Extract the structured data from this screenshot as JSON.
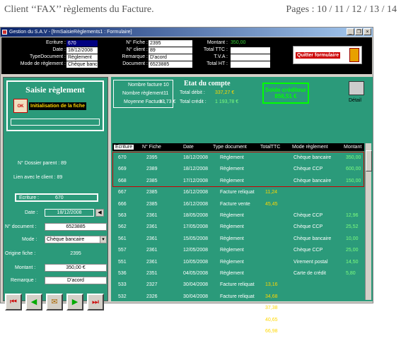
{
  "page_header": {
    "title": "Client ‘‘FAX’’ règlements du Facture.",
    "pages": "Pages : 10 / 11 / 12 / 13 / 14"
  },
  "window": {
    "title": "Gestion du S.A.V - [frmSaisieRèglements1 : Formulaire]",
    "min": "_",
    "restore": "❐",
    "close": "×"
  },
  "top": {
    "ecriture_label": "Ecriture :",
    "ecriture": "670",
    "date_label": "Date :",
    "date": "18/12/2008",
    "typedoc_label": "TypeDocument :",
    "typedoc": "Règlement",
    "mode_label": "Mode de règlement :",
    "mode": "Chèque bancaire",
    "nfiche_label": "N° Fiche :",
    "nfiche": "2395",
    "nclient_label": "N° client :",
    "nclient": "89",
    "remarque_label": "Remarque :",
    "remarque": "D'acord",
    "document_label": "Document :",
    "document": "6523885",
    "montant_label": "Montant :",
    "montant": "350,00",
    "ttc_label": "Total TTC :",
    "tva_label": "T.V.A :",
    "ht_label": "Total HT :",
    "quit": "Quitter formulaire"
  },
  "left": {
    "title": "Saisie règlement",
    "ok": "OK",
    "init": "Initialisation de la fiche",
    "dossier_parent": "N° Dossier parent :  89",
    "lien": "Lien avec le client :  89",
    "ecriture_label": "Ecriture :",
    "ecriture": "670",
    "date_label": "Date :",
    "date": "18/12/2008",
    "doc_label": "N° document :",
    "doc": "6523885",
    "mode_label": "Mode :",
    "mode": "Chèque bancaire",
    "origine_label": "Origine fiche :",
    "origine": "2395",
    "montant_label": "Montant :",
    "montant": "350,00 €",
    "remarque_label": "Remarque :",
    "remarque": "D'acord",
    "nav": [
      "⏮",
      "◀",
      "✉",
      "▶",
      "⏭"
    ]
  },
  "stats": {
    "nbfact_label": "Nombre facture :",
    "nbfact": "10",
    "nbregl_label": "Nombre règlement :",
    "nbregl": "11",
    "moy_label": "Moyenne Facture :",
    "moy": "33,73 €",
    "etat_title": "Etat du compte",
    "debit_label": "Total débit :",
    "debit": "337,27 €",
    "credit_label": "Total crédit :",
    "credit": "1 193,78 €",
    "solde_label": "Solde créditeur",
    "solde": "856,51 €",
    "detail": "Détail"
  },
  "table": {
    "headers": [
      "Ecriture",
      "N° Fiche",
      "Date",
      "Type document",
      "TotalTTC",
      "Mode règlement",
      "Montant"
    ],
    "rows": [
      [
        "670",
        "2395",
        "18/12/2008",
        "Règlement",
        "",
        "Chèque bancaire",
        "350,00"
      ],
      [
        "669",
        "2389",
        "18/12/2008",
        "Règlement",
        "",
        "Chèque CCP",
        "600,00"
      ],
      [
        "668",
        "2385",
        "17/12/2008",
        "Règlement",
        "",
        "Chèque bancaire",
        "150,00"
      ],
      [
        "667",
        "2385",
        "16/12/2008",
        "Facture reliquat",
        "11,24",
        "",
        ""
      ],
      [
        "666",
        "2385",
        "16/12/2008",
        "Facture vente",
        "45,45",
        "",
        ""
      ],
      [
        "563",
        "2361",
        "18/05/2008",
        "Règlement",
        "",
        "Chèque CCP",
        "12,96"
      ],
      [
        "562",
        "2361",
        "17/05/2008",
        "Règlement",
        "",
        "Chèque CCP",
        "25,52"
      ],
      [
        "561",
        "2361",
        "15/05/2008",
        "Règlement",
        "",
        "Chèque bancaire",
        "10,00"
      ],
      [
        "557",
        "2361",
        "12/05/2008",
        "Règlement",
        "",
        "Chèque CCP",
        "25,00"
      ],
      [
        "551",
        "2361",
        "10/05/2008",
        "Règlement",
        "",
        "Virement postal",
        "14,50"
      ],
      [
        "536",
        "2351",
        "04/05/2008",
        "Règlement",
        "",
        "Carte de crédit",
        "5,80"
      ],
      [
        "533",
        "2327",
        "30/04/2008",
        "Facture reliquat",
        "13,16",
        "",
        ""
      ],
      [
        "532",
        "2326",
        "30/04/2008",
        "Facture reliquat",
        "34,68",
        "",
        ""
      ],
      [
        "531",
        "2326",
        "30/04/2008",
        "Facture vente",
        "37,38",
        "",
        ""
      ],
      [
        "530",
        "2325",
        "30/04/2008",
        "Facture vente",
        "40,65",
        "",
        ""
      ],
      [
        "528",
        "2319",
        "29/04/2008",
        "Facture reliquat",
        "66,98",
        "",
        ""
      ]
    ]
  }
}
